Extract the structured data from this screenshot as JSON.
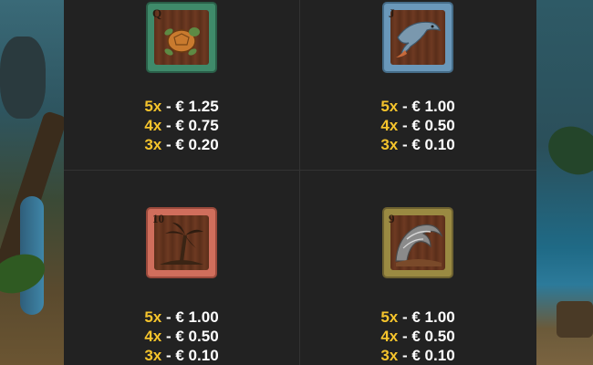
{
  "paytable": [
    {
      "symbol": "turtle",
      "rank": "Q",
      "frame_color": "#3f8a6a",
      "pays": [
        {
          "mult": "5x",
          "amount": "- € 1.25"
        },
        {
          "mult": "4x",
          "amount": "- € 0.75"
        },
        {
          "mult": "3x",
          "amount": "- € 0.20"
        }
      ]
    },
    {
      "symbol": "dolphin",
      "rank": "J",
      "frame_color": "#6a98ba",
      "pays": [
        {
          "mult": "5x",
          "amount": "- € 1.00"
        },
        {
          "mult": "4x",
          "amount": "- € 0.50"
        },
        {
          "mult": "3x",
          "amount": "- € 0.10"
        }
      ]
    },
    {
      "symbol": "palm-tree",
      "rank": "10",
      "frame_color": "#d06e5c",
      "pays": [
        {
          "mult": "5x",
          "amount": "- € 1.00"
        },
        {
          "mult": "4x",
          "amount": "- € 0.50"
        },
        {
          "mult": "3x",
          "amount": "- € 0.10"
        }
      ]
    },
    {
      "symbol": "wave",
      "rank": "9",
      "frame_color": "#9a8a42",
      "pays": [
        {
          "mult": "5x",
          "amount": "- € 1.00"
        },
        {
          "mult": "4x",
          "amount": "- € 0.50"
        },
        {
          "mult": "3x",
          "amount": "- € 0.10"
        }
      ]
    }
  ],
  "colors": {
    "multiplier": "#f5c42c",
    "amount": "#ffffff",
    "panel": "#222222"
  }
}
